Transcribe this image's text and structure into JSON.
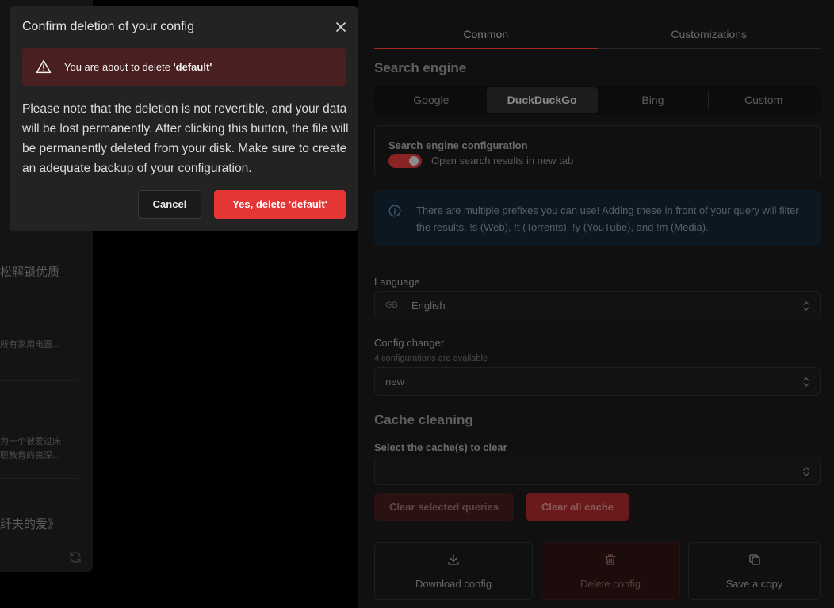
{
  "modal": {
    "title": "Confirm deletion of your config",
    "alert_prefix": "You are about to delete ",
    "alert_name": "'default'",
    "body": "Please note that the deletion is not revertible, and your data will be lost permanently. After clicking this button, the file will be permanently deleted from your disk. Make sure to create an adequate backup of your configuration.",
    "cancel_label": "Cancel",
    "confirm_prefix": "Yes, delete ",
    "confirm_name": "'default'"
  },
  "tabs": [
    {
      "label": "Common"
    },
    {
      "label": "Customizations"
    }
  ],
  "search_engine": {
    "heading": "Search engine",
    "options": [
      "Google",
      "DuckDuckGo",
      "Bing",
      "Custom"
    ],
    "selected": "DuckDuckGo",
    "config_title": "Search engine configuration",
    "toggle_label": "Open search results in new tab",
    "toggle_on": true
  },
  "info": {
    "text": "There are multiple prefixes you can use! Adding these in front of your query will filter the results. !s (Web), !t (Torrents), !y (YouTube), and !m (Media)."
  },
  "language": {
    "label": "Language",
    "prefix": "GB",
    "value": "English"
  },
  "config_changer": {
    "label": "Config changer",
    "sublabel": "4 configurations are available",
    "value": "new"
  },
  "cache": {
    "heading": "Cache cleaning",
    "select_label": "Select the cache(s) to clear",
    "select_value": "",
    "clear_selected_label": "Clear selected queries",
    "clear_all_label": "Clear all cache"
  },
  "config_actions": [
    {
      "label": "Download config",
      "icon": "download-icon"
    },
    {
      "label": "Delete config",
      "icon": "trash-icon"
    },
    {
      "label": "Save a copy",
      "icon": "copy-icon"
    }
  ],
  "feed": {
    "t1": "松解锁优质",
    "t2": "所有家用电器...",
    "t3a": "为一个被爱过床",
    "t3b": "职教育的资深...",
    "t4": "纤夫的爱》"
  },
  "colors": {
    "accent": "#e53535",
    "alert_bg": "#4a1f1f",
    "info_bg": "#0c1821"
  }
}
